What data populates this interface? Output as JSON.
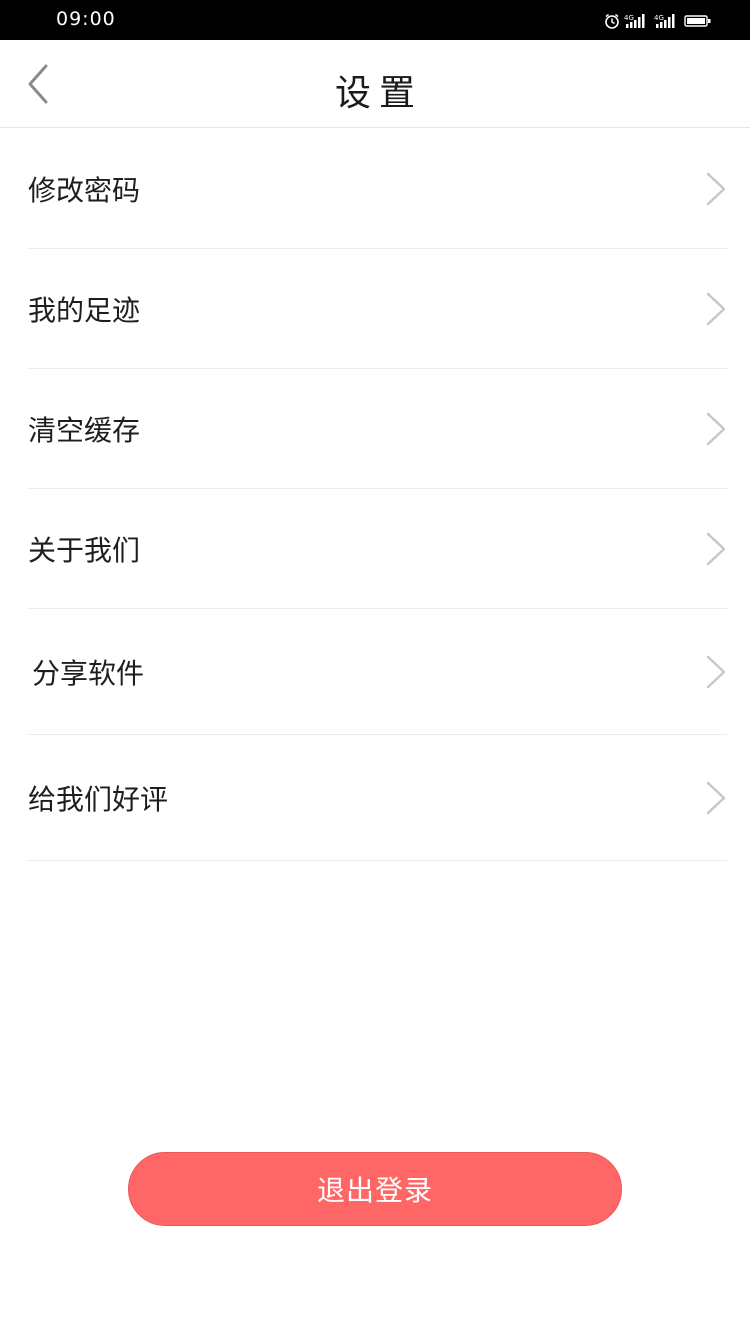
{
  "status_bar": {
    "time": "09:00",
    "icons": [
      "alarm-icon",
      "signal-icon",
      "signal-icon",
      "battery-icon"
    ]
  },
  "header": {
    "title": "设置",
    "back_icon": "chevron-left-icon"
  },
  "settings": {
    "items": [
      {
        "label": "修改密码",
        "icon": "chevron-right-icon"
      },
      {
        "label": "我的足迹",
        "icon": "chevron-right-icon"
      },
      {
        "label": "清空缓存",
        "icon": "chevron-right-icon"
      },
      {
        "label": "关于我们",
        "icon": "chevron-right-icon"
      },
      {
        "label": "分享软件",
        "icon": "chevron-right-icon"
      },
      {
        "label": "给我们好评",
        "icon": "chevron-right-icon"
      }
    ]
  },
  "logout": {
    "label": "退出登录",
    "color": "#ff6766"
  },
  "colors": {
    "status_bar_bg": "#000000",
    "divider": "#ececec",
    "text": "#1e1e1e",
    "chevron": "#c8c8c8"
  }
}
